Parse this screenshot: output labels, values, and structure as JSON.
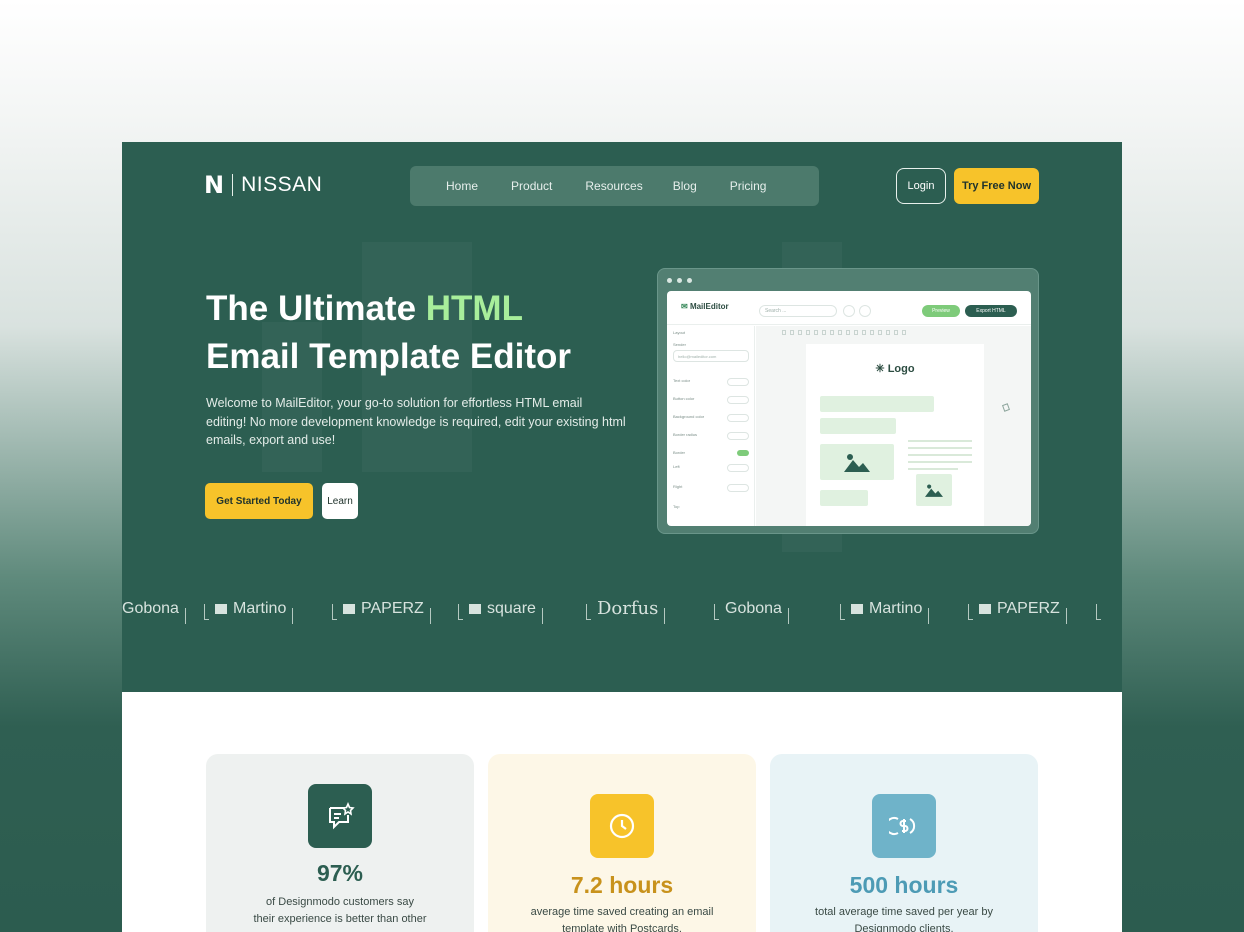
{
  "header": {
    "logo_mark": "N",
    "brand": "NISSAN",
    "nav": [
      "Home",
      "Product",
      "Resources",
      "Blog",
      "Pricing"
    ],
    "login_label": "Login",
    "cta_label": "Try Free Now"
  },
  "hero": {
    "title_pre": "The Ultimate ",
    "title_highlight": "HTML",
    "title_line2": "Email Template Editor",
    "lead": "Welcome to MailEditor, your go-to solution for effortless HTML email editing! No more development knowledge is required, edit your existing html emails, export and use!",
    "primary_label": "Get Started Today",
    "secondary_label": "Learn"
  },
  "mock_editor": {
    "app_name": "MailEditor",
    "search_placeholder": "Search ...",
    "preview_label": "Preview",
    "export_label": "Export HTML",
    "canvas_logo": "✳ Logo",
    "side_labels": [
      "Layout",
      "Sender",
      "Text color",
      "Button color",
      "Background color",
      "Border radius",
      "Border",
      "Left",
      "Right",
      "Top"
    ],
    "side_sender_value": "hello@maileditor.com"
  },
  "brands": [
    "Gobona",
    "Martino",
    "PAPERZ",
    "square",
    "Dorfus",
    "Gobona",
    "Martino",
    "PAPERZ"
  ],
  "stats": [
    {
      "value": "97%",
      "desc_line1": "of Designmodo customers say",
      "desc_line2": "their experience is better than other",
      "color": "#2c5e51",
      "bg": "#eef1f0",
      "icon": "chat-star-icon"
    },
    {
      "value": "7.2 hours",
      "desc_line1": "average time saved creating an email",
      "desc_line2": "template with Postcards.",
      "color": "#f7c32a",
      "bg": "#fdf7e7",
      "icon": "clock-icon"
    },
    {
      "value": "500 hours",
      "desc_line1": "total average time saved per year by",
      "desc_line2": "Designmodo clients.",
      "color": "#6fb3c9",
      "bg": "#e8f3f6",
      "icon": "coin-icon"
    }
  ],
  "colors": {
    "hero_bg": "#2c5e51",
    "accent_yellow": "#f7c32a",
    "highlight_green": "#a8ee9b"
  }
}
